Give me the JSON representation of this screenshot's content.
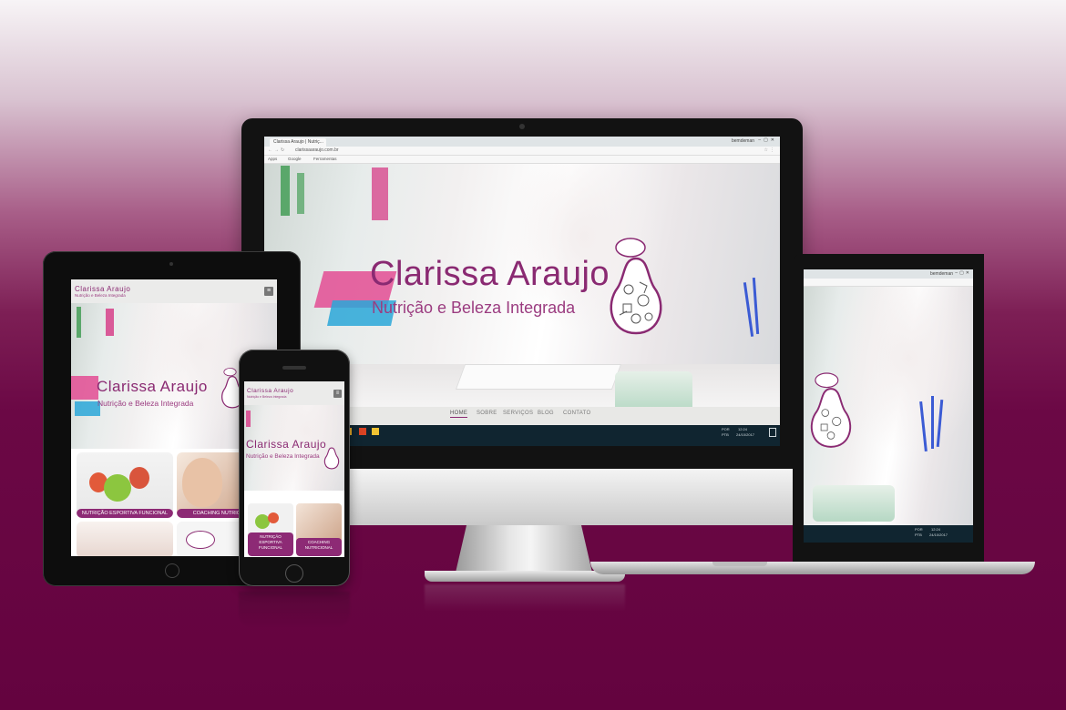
{
  "brand": {
    "name": "Clarissa Araujo",
    "tagline": "Nutrição e Beleza Integrada"
  },
  "browser": {
    "tab_title": "Clarissa Araujo | Nutriç...",
    "window_user": "bemdeman",
    "address": "clarissaaraujo.com.br",
    "bookmarks": [
      "Apps",
      "Google",
      "Ferramentas"
    ]
  },
  "nav": {
    "items": [
      "HOME",
      "SOBRE",
      "SERVIÇOS",
      "BLOG",
      "CONTATO"
    ],
    "active": "HOME"
  },
  "taskbar": {
    "lang_line1": "POR",
    "lang_line2": "PTB",
    "time": "12:24",
    "date": "24/10/2017"
  },
  "services": [
    {
      "label": "NUTRIÇÃO ESPORTIVA FUNCIONAL"
    },
    {
      "label": "COACHING NUTRICIONAL"
    }
  ],
  "phone_services": [
    {
      "label_line1": "NUTRIÇÃO",
      "label_line2": "ESPORTIVA",
      "label_line3": "FUNCIONAL"
    },
    {
      "label_line1": "COACHING",
      "label_line2": "NUTRICIONAL"
    }
  ],
  "colors": {
    "brand": "#8a2a72",
    "background_top": "#f7f4f6",
    "background_bottom": "#64033f",
    "taskbar": "#102530"
  }
}
